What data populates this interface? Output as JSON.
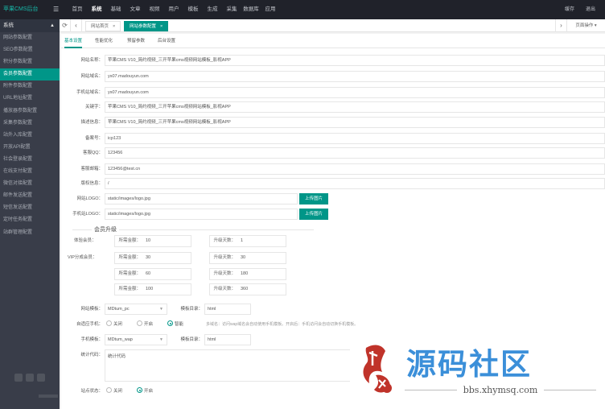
{
  "topbar": {
    "logo": "苹果CMS后台",
    "nav": [
      "首页",
      "系统",
      "基础",
      "文章",
      "视频",
      "用户",
      "模板",
      "生成",
      "采集",
      "数据库",
      "应用"
    ],
    "active_nav": 1,
    "right_items": [
      "缓存",
      "退出"
    ]
  },
  "sidebar": {
    "head": "系统",
    "items": [
      "网站参数配置",
      "SEO参数配置",
      "积分参数配置",
      "会员参数配置",
      "附件参数配置",
      "URL地址配置",
      "播放器参数配置",
      "采集参数配置",
      "站外入库配置",
      "开放API配置",
      "社会登录配置",
      "在线支付配置",
      "微信对接配置",
      "邮件发送配置",
      "短信发送配置",
      "定时任务配置",
      "站群管理配置"
    ],
    "active_index": 3
  },
  "tabbar": {
    "tabs": [
      "网站首页",
      "网站参数配置"
    ],
    "active": 1,
    "right_label": "页面操作"
  },
  "subtabs": [
    "基本设置",
    "性能优化",
    "预留参数",
    "后台设置"
  ],
  "form": {
    "site_name": {
      "label": "网站名称：",
      "value": "苹果CMS V10_简约视频_三开苹果cms视频网站模板_影视APP"
    },
    "site_url": {
      "label": "网站域名：",
      "value": "ys07.madouyun.com"
    },
    "mobile_url": {
      "label": "手机站域名：",
      "value": "ys07.madouyun.com"
    },
    "keywords": {
      "label": "关键字：",
      "value": "苹果CMS V10_简约视频_三开苹果cms视频网站模板_影视APP"
    },
    "description": {
      "label": "描述信息：",
      "value": "苹果CMS V10_简约视频_三开苹果cms视频网站模板_影视APP"
    },
    "icp": {
      "label": "备案号：",
      "value": "icp123"
    },
    "qq": {
      "label": "客服QQ：",
      "value": "123456"
    },
    "email": {
      "label": "客服邮箱：",
      "value": "123456@test.cn"
    },
    "copyright": {
      "label": "版权信息：",
      "value": "/"
    },
    "pc_logo": {
      "label": "网站LOGO：",
      "value": "static/images/logo.jpg",
      "button": "上传图片"
    },
    "mobile_logo": {
      "label": "手机站LOGO：",
      "value": "static/images/logo.jpg",
      "button": "上传图片"
    }
  },
  "member": {
    "legend": "会员升级",
    "trial_label": "体验会员：",
    "vip_label": "VIP分成会员：",
    "trial": [
      {
        "key": "所需金额：",
        "value": "10"
      },
      {
        "key": "升级天数：",
        "value": "1"
      }
    ],
    "vip": [
      {
        "key": "所需金额：",
        "value": "30"
      },
      {
        "key": "升级天数：",
        "value": "30"
      },
      {
        "key": "所需金额：",
        "value": "60"
      },
      {
        "key": "升级天数：",
        "value": "180"
      },
      {
        "key": "所需金额：",
        "value": "100"
      },
      {
        "key": "升级天数：",
        "value": "360"
      }
    ]
  },
  "template": {
    "pc_label": "网站模板：",
    "pc_value": "MDtum_pc",
    "pc_dir_label": "模板目录：",
    "pc_dir_value": "html",
    "mode_label": "自适应手机：",
    "mode_options": [
      "关闭",
      "开启",
      "智能"
    ],
    "mode_selected": 2,
    "mode_tip": "多域名：访问wap域名会自动使用手机模板。开启后：手机访问会自动切换手机模板。",
    "mobile_label": "手机模板：",
    "mobile_value": "MDtum_wap",
    "mobile_dir_label": "模板目录：",
    "mobile_dir_value": "html",
    "stats_label": "统计代码：",
    "stats_value": "统计代码",
    "status_label": "站点状态：",
    "status_options": [
      "关闭",
      "开启"
    ],
    "status_selected": 1
  },
  "watermark": {
    "title": "源码社区",
    "url": "bbs.xhymsq.com",
    "brand_color": "#3b8fd9",
    "seal_color": "#c0332a"
  },
  "colors": {
    "accent": "#009688",
    "topbar": "#20222a",
    "sidebar": "#393d49"
  }
}
